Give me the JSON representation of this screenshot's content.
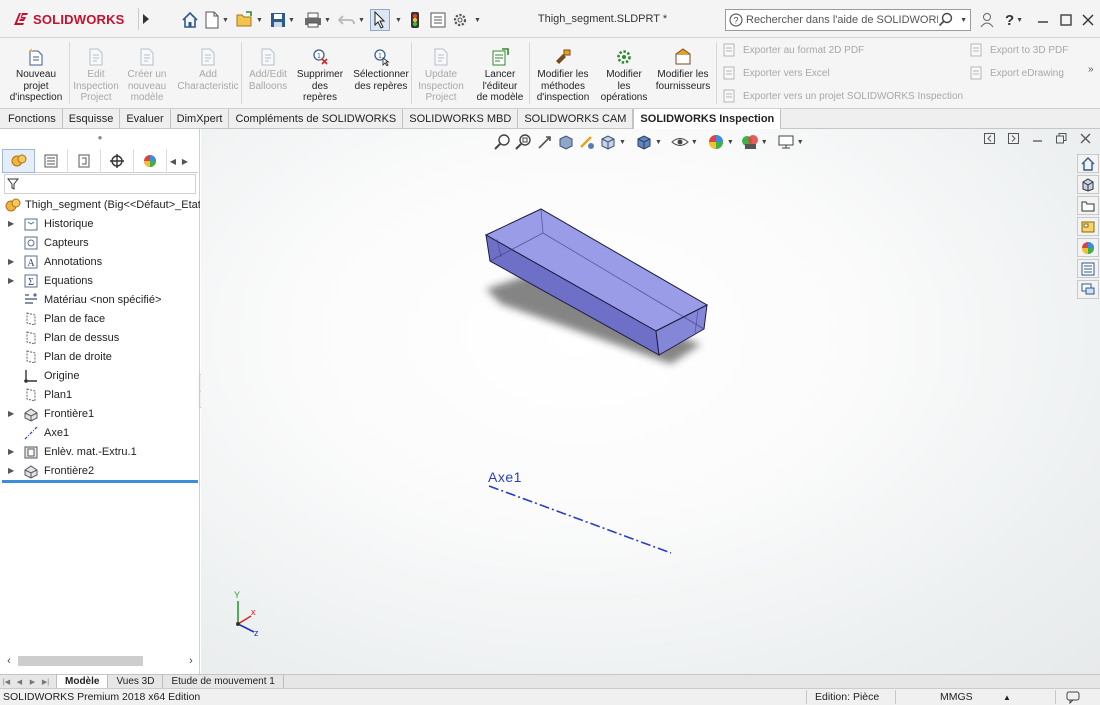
{
  "app": {
    "brand": "SOLIDWORKS",
    "document_title": "Thigh_segment.SLDPRT *"
  },
  "help_search": {
    "placeholder": "Rechercher dans l'aide de SOLIDWORKS"
  },
  "quick_access": [
    "home-icon",
    "new-document-icon",
    "open-icon",
    "save-icon",
    "print-icon",
    "undo-icon",
    "select-icon",
    "rebuild-icon",
    "file-properties-icon",
    "options-icon"
  ],
  "ribbon": {
    "buttons": [
      {
        "label": "Nouveau\nprojet\nd'inspection",
        "enabled": true,
        "icon": "new-inspection-project-icon"
      },
      {
        "label": "Edit\nInspection\nProject",
        "enabled": false,
        "icon": "edit-project-icon"
      },
      {
        "label": "Créer un\nnouveau\nmodèle",
        "enabled": false,
        "icon": "new-template-icon"
      },
      {
        "label": "Add\nCharacteristic",
        "enabled": false,
        "icon": "add-characteristic-icon"
      },
      {
        "label": "Add/Edit\nBalloons",
        "enabled": false,
        "icon": "balloons-icon"
      },
      {
        "label": "Supprimer\ndes\nrepères",
        "enabled": true,
        "icon": "delete-balloons-icon"
      },
      {
        "label": "Sélectionner\ndes repères",
        "enabled": true,
        "icon": "select-balloons-icon"
      },
      {
        "label": "Update\nInspection\nProject",
        "enabled": false,
        "icon": "update-project-icon"
      },
      {
        "label": "Lancer\nl'éditeur\nde modèle",
        "enabled": true,
        "icon": "template-editor-icon"
      },
      {
        "label": "Modifier les\nméthodes\nd'inspection",
        "enabled": true,
        "icon": "inspection-methods-icon"
      },
      {
        "label": "Modifier\nles\nopérations",
        "enabled": true,
        "icon": "operations-icon"
      },
      {
        "label": "Modifier les\nfournisseurs",
        "enabled": true,
        "icon": "vendors-icon"
      }
    ],
    "export_left": [
      "Exporter au format 2D PDF",
      "Exporter vers Excel",
      "Exporter vers un projet SOLIDWORKS Inspection"
    ],
    "export_right": [
      "Export to 3D PDF",
      "Export eDrawing"
    ]
  },
  "tabs": [
    {
      "label": "Fonctions",
      "active": false
    },
    {
      "label": "Esquisse",
      "active": false
    },
    {
      "label": "Evaluer",
      "active": false
    },
    {
      "label": "DimXpert",
      "active": false
    },
    {
      "label": "Compléments de SOLIDWORKS",
      "active": false
    },
    {
      "label": "SOLIDWORKS MBD",
      "active": false
    },
    {
      "label": "SOLIDWORKS CAM",
      "active": false
    },
    {
      "label": "SOLIDWORKS Inspection",
      "active": true
    }
  ],
  "panel_tabs": [
    "feature-manager-icon",
    "property-manager-icon",
    "configuration-manager-icon",
    "dimxpert-manager-icon",
    "display-manager-icon"
  ],
  "tree": {
    "root": "Thigh_segment  (Big<<Défaut>_Etat d",
    "items": [
      {
        "label": "Historique",
        "expandable": true,
        "icon": "history-icon"
      },
      {
        "label": "Capteurs",
        "expandable": false,
        "icon": "sensors-icon"
      },
      {
        "label": "Annotations",
        "expandable": true,
        "icon": "annotations-icon"
      },
      {
        "label": "Equations",
        "expandable": true,
        "icon": "equations-icon"
      },
      {
        "label": "Matériau <non spécifié>",
        "expandable": false,
        "icon": "material-icon"
      },
      {
        "label": "Plan de face",
        "expandable": false,
        "icon": "plane-icon"
      },
      {
        "label": "Plan de dessus",
        "expandable": false,
        "icon": "plane-icon"
      },
      {
        "label": "Plan de droite",
        "expandable": false,
        "icon": "plane-icon"
      },
      {
        "label": "Origine",
        "expandable": false,
        "icon": "origin-icon"
      },
      {
        "label": "Plan1",
        "expandable": false,
        "icon": "plane-icon"
      },
      {
        "label": "Frontière1",
        "expandable": true,
        "icon": "boundary-icon"
      },
      {
        "label": "Axe1",
        "expandable": false,
        "icon": "axis-icon"
      },
      {
        "label": "Enlèv. mat.-Extru.1",
        "expandable": true,
        "icon": "extruded-cut-icon"
      },
      {
        "label": "Frontière2",
        "expandable": true,
        "icon": "boundary-icon"
      }
    ]
  },
  "viewport": {
    "axis_label": "Axe1",
    "triad": {
      "x": "x",
      "y": "Y",
      "z": "z"
    },
    "heads_up_icons": [
      "zoom-to-fit-icon",
      "zoom-to-area-icon",
      "previous-view-icon",
      "section-view-icon",
      "dynamic-annotation-icon",
      "view-orientation-icon",
      "display-style-icon",
      "hide-show-icon",
      "edit-appearance-icon",
      "apply-scene-icon",
      "view-settings-icon"
    ],
    "task_pane": [
      "resources-icon",
      "design-library-icon",
      "file-explorer-icon",
      "view-palette-icon",
      "appearances-icon",
      "custom-properties-icon",
      "forum-icon"
    ],
    "model_color": "#7d7fd6",
    "axis_color": "#2b3ec4"
  },
  "bottom_tabs": [
    {
      "label": "Modèle",
      "active": true
    },
    {
      "label": "Vues 3D",
      "active": false
    },
    {
      "label": "Etude de mouvement 1",
      "active": false
    }
  ],
  "status": {
    "left": "SOLIDWORKS Premium 2018 x64 Edition",
    "mode": "Edition: Pièce",
    "units": "MMGS"
  }
}
